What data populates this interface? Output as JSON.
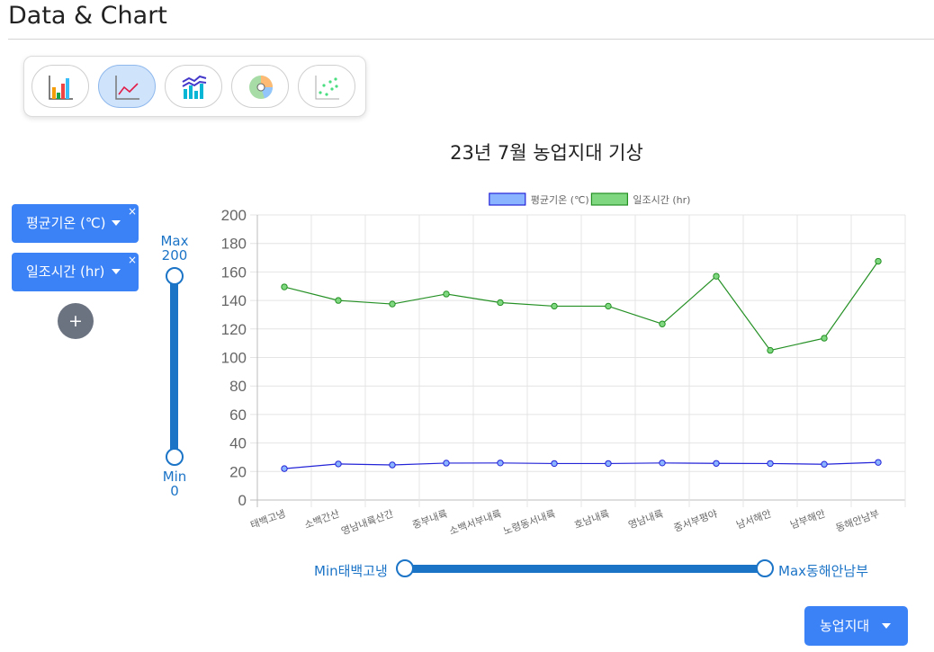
{
  "page": {
    "title": "Data & Chart"
  },
  "chart_types": [
    {
      "name": "bar-chart",
      "active": false
    },
    {
      "name": "line-chart",
      "active": true
    },
    {
      "name": "combo-chart",
      "active": false
    },
    {
      "name": "pie-chart",
      "active": false
    },
    {
      "name": "scatter-chart",
      "active": false
    }
  ],
  "series_controls": [
    {
      "label": "평균기온 (℃)",
      "close": "×"
    },
    {
      "label": "일조시간 (hr)",
      "close": "×"
    }
  ],
  "add_button": "+",
  "y_slider": {
    "max_label": "Max",
    "max_value": "200",
    "min_label": "Min",
    "min_value": "0"
  },
  "x_slider": {
    "min_label": "Min태백고냉",
    "max_label": "Max동해안남부"
  },
  "group_button": {
    "label": "농업지대"
  },
  "colors": {
    "accent": "#3b82f6",
    "slider": "#1c74c7",
    "series1": "#2323d8",
    "series2": "#249024"
  },
  "chart_data": {
    "type": "line",
    "title": "23년 7월 농업지대 기상",
    "categories": [
      "태백고냉",
      "소백간산",
      "영남내륙산간",
      "중부내륙",
      "소백서부내륙",
      "노령동서내륙",
      "호남내륙",
      "영남내륙",
      "중서부평야",
      "남서해안",
      "남부해안",
      "동해안남부"
    ],
    "series": [
      {
        "name": "평균기온 (℃)",
        "values": [
          22,
          25.3,
          24.6,
          25.9,
          26,
          25.6,
          25.6,
          26,
          25.7,
          25.6,
          25.1,
          26.4
        ],
        "color": "#2323d8",
        "fill": "#8ab4ff"
      },
      {
        "name": "일조시간 (hr)",
        "values": [
          149.5,
          140,
          137.5,
          144.5,
          138.5,
          136,
          136,
          123.5,
          157,
          105,
          113.5,
          167.5
        ],
        "color": "#249024",
        "fill": "#7fd87f"
      }
    ],
    "ylim": [
      0,
      200
    ],
    "yticks": [
      "0",
      "20",
      "40",
      "60",
      "80",
      "100",
      "120",
      "140",
      "160",
      "180",
      "200"
    ],
    "grid": true,
    "legend": "top"
  }
}
